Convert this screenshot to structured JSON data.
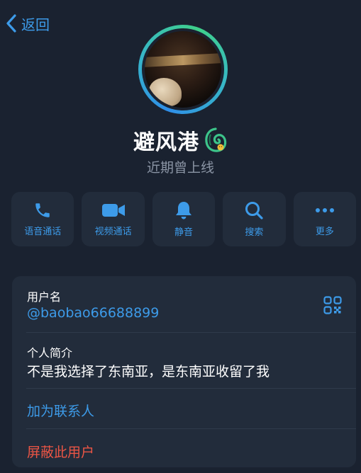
{
  "nav": {
    "back_label": "返回"
  },
  "profile": {
    "name": "避风港",
    "status": "近期曾上线"
  },
  "actions": [
    {
      "label": "语音通话",
      "icon": "phone-icon"
    },
    {
      "label": "视频通话",
      "icon": "video-camera-icon"
    },
    {
      "label": "静音",
      "icon": "bell-icon"
    },
    {
      "label": "搜索",
      "icon": "search-icon"
    },
    {
      "label": "更多",
      "icon": "more-dots-icon"
    }
  ],
  "info": {
    "username_label": "用户名",
    "username": "@baobao66688899",
    "bio_label": "个人简介",
    "bio": "不是我选择了东南亚，是东南亚收留了我",
    "add_contact": "加为联系人",
    "block_user": "屏蔽此用户"
  },
  "colors": {
    "background": "#1a2230",
    "card": "#222c3b",
    "accent": "#3d9be9",
    "danger": "#eb5545",
    "secondary_text": "#8b95a5"
  }
}
